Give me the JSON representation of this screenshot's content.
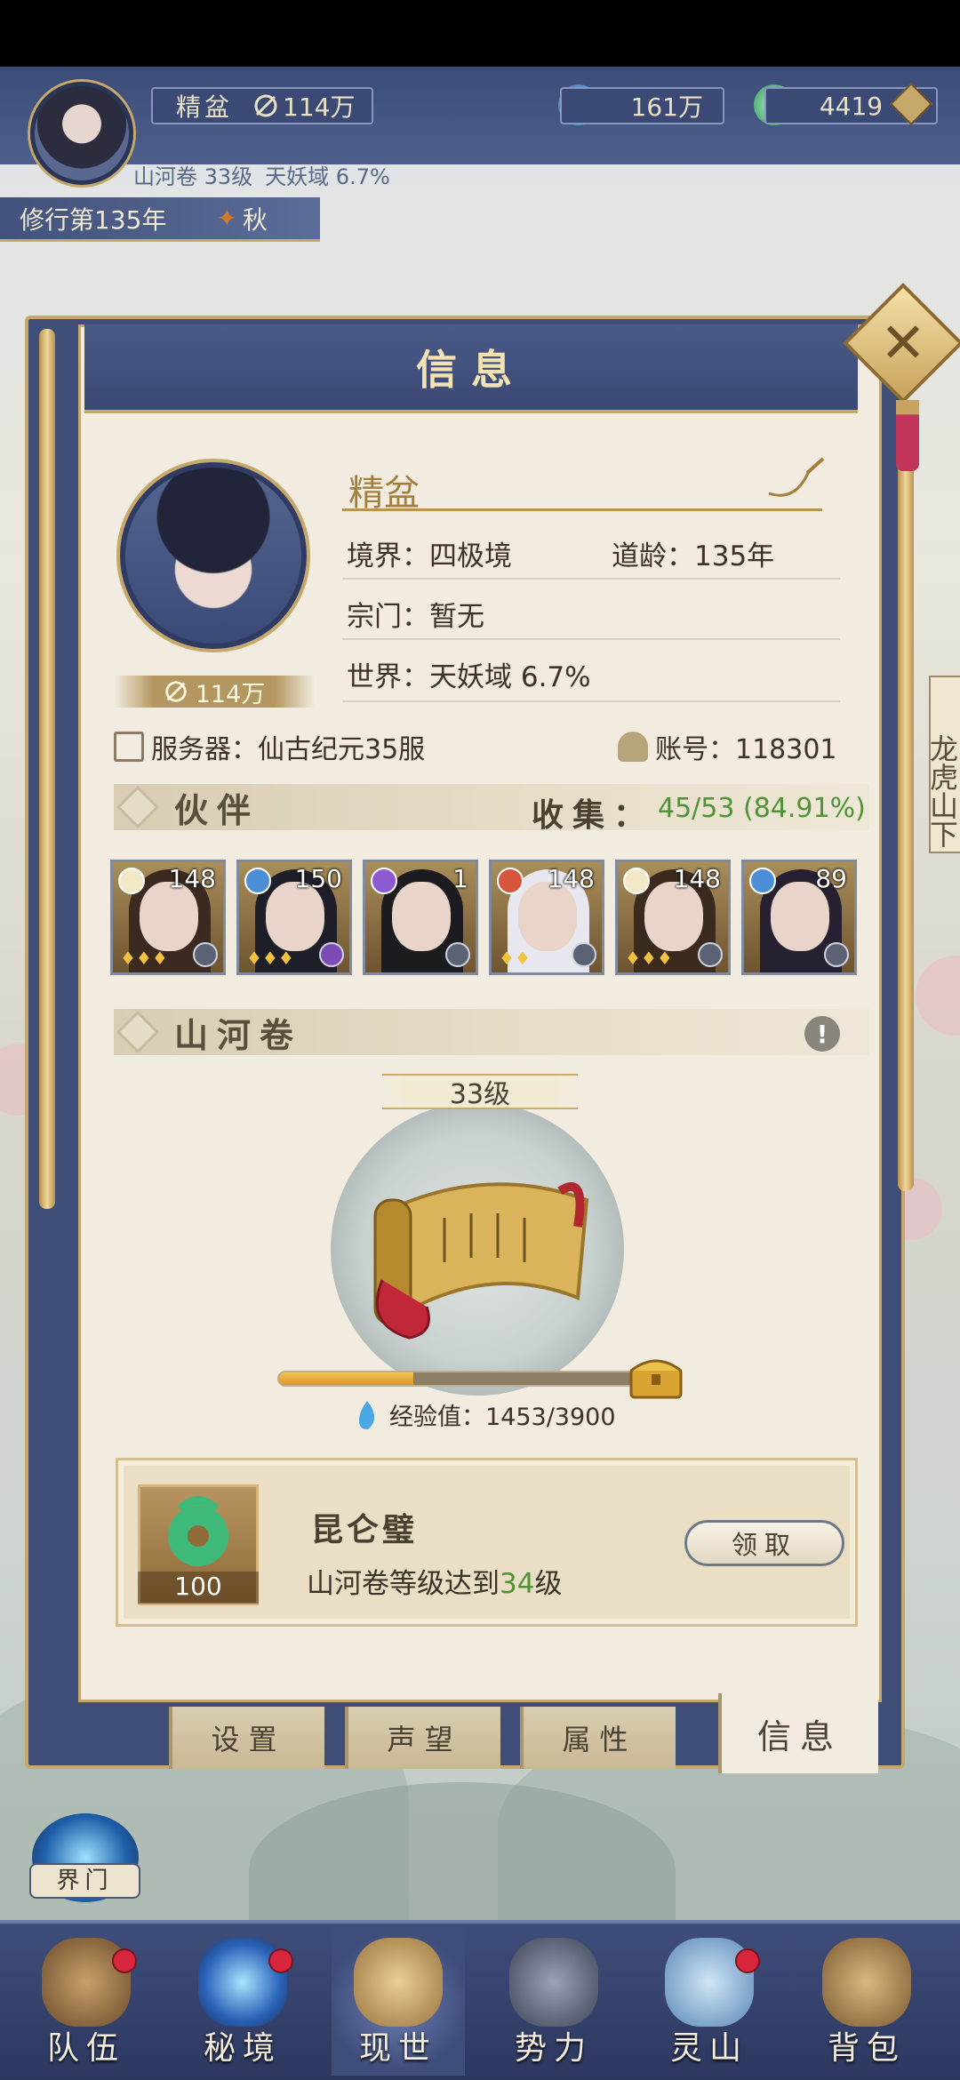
{
  "hud": {
    "player_name": "精盆",
    "power": "114万",
    "jade": "161万",
    "coins": "4419",
    "sub_info_scroll": "山河卷 33级",
    "sub_info_world": "天妖域 6.7%",
    "cultivation_year": "修行第135年",
    "season": "秋"
  },
  "dialog": {
    "title": "信息",
    "close_symbol": "✕",
    "profile": {
      "name": "精盆",
      "power": "114万",
      "realm": "境界：四极境",
      "age": "道龄：135年",
      "sect": "宗门：暂无",
      "world": "世界：天妖域  6.7%",
      "server": "服务器：仙古纪元35服",
      "account": "账号：118301"
    },
    "partners_section": {
      "title": "伙伴",
      "collect_label": "收集：",
      "collect_value": "45/53 (84.91%)",
      "partners": [
        {
          "level": "148",
          "element": "light",
          "stars": "♦♦♦"
        },
        {
          "level": "150",
          "element": "water",
          "stars": "♦♦♦"
        },
        {
          "level": "1",
          "element": "dark",
          "stars": ""
        },
        {
          "level": "148",
          "element": "fire",
          "stars": "♦♦"
        },
        {
          "level": "148",
          "element": "light",
          "stars": "♦♦♦"
        },
        {
          "level": "89",
          "element": "water",
          "stars": ""
        }
      ]
    },
    "scroll_section": {
      "title": "山河卷",
      "info_symbol": "!",
      "level": "33级",
      "exp_label": "经验值：1453/3900",
      "exp_progress": 0.3726
    },
    "reward": {
      "item_count": "100",
      "name": "昆仑璧",
      "desc_prefix": "山河卷等级达到",
      "desc_level": "34",
      "desc_suffix": "级",
      "claim_label": "领取"
    },
    "tabs": [
      {
        "label": "设置"
      },
      {
        "label": "声望"
      },
      {
        "label": "属性"
      },
      {
        "label": "信息",
        "active": true
      }
    ]
  },
  "side_place": "龙虎山下",
  "realm_gate_label": "界门",
  "nav": [
    {
      "label": "队伍",
      "badge": true
    },
    {
      "label": "秘境",
      "badge": true
    },
    {
      "label": "现世",
      "badge": false,
      "active": true
    },
    {
      "label": "势力",
      "badge": false
    },
    {
      "label": "灵山",
      "badge": true
    },
    {
      "label": "背包",
      "badge": false
    }
  ],
  "colors": {
    "frame_blue": "#3f4d79",
    "gold": "#c6a86a",
    "paper": "#f1ecdf",
    "green_text": "#4f9336",
    "badge_red": "#d7263d"
  }
}
